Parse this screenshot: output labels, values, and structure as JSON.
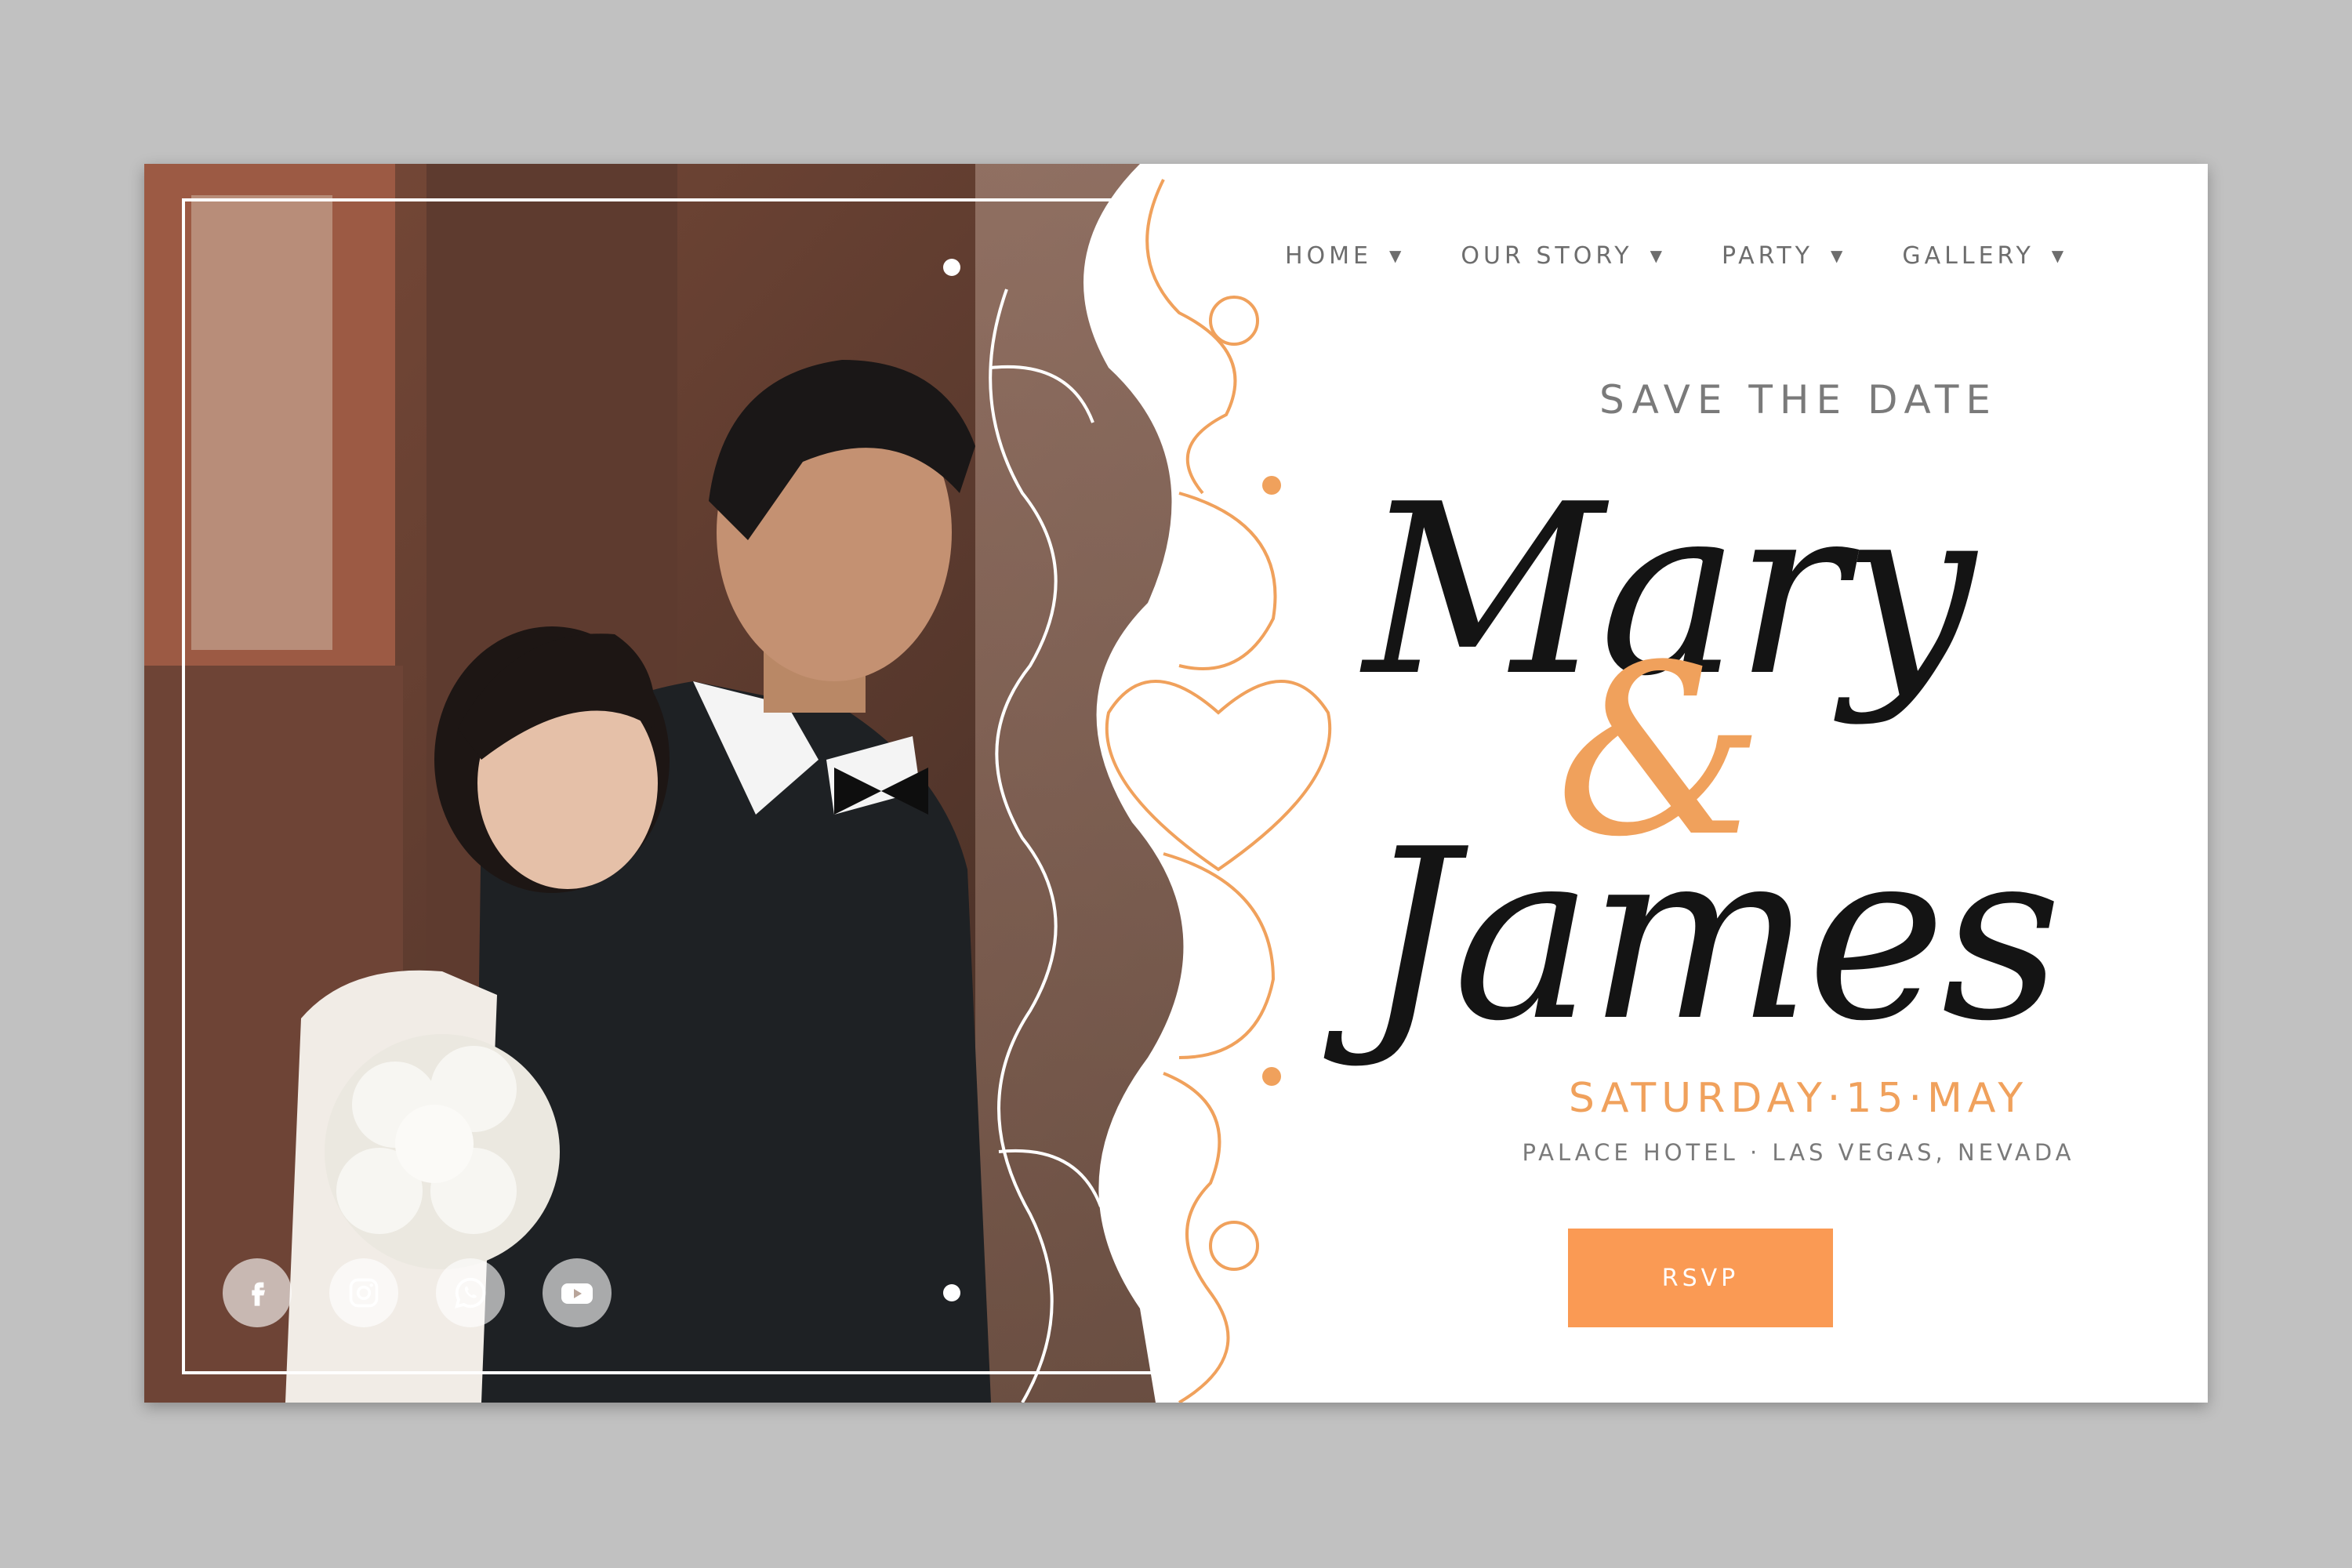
{
  "nav": {
    "items": [
      {
        "label": "HOME",
        "caret": "▼"
      },
      {
        "label": "OUR STORY",
        "caret": "▼"
      },
      {
        "label": "PARTY",
        "caret": "▼"
      },
      {
        "label": "GALLERY",
        "caret": "▼"
      }
    ]
  },
  "hero": {
    "tagline": "SAVE THE DATE",
    "name_1": "Mary",
    "ampersand": "&",
    "name_2": "James",
    "date": "SATURDAY·15·MAY",
    "venue": "PALACE HOTEL · LAS VEGAS, NEVADA",
    "rsvp_label": "RSVP"
  },
  "social": [
    "facebook-icon",
    "instagram-icon",
    "whatsapp-icon",
    "youtube-icon"
  ],
  "colors": {
    "accent": "#f0a15c",
    "button": "#fa9a54",
    "text_dark": "#141414",
    "text_muted": "#7a7a7a",
    "backdrop": "#c1c1c1"
  }
}
